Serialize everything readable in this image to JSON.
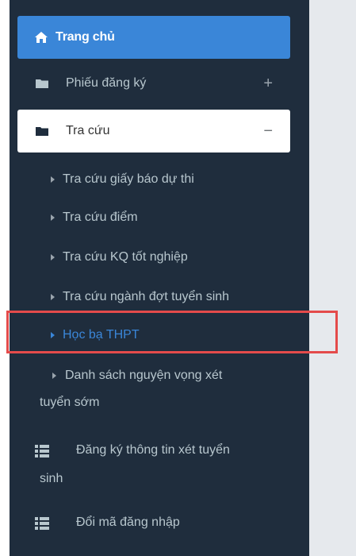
{
  "sidebar": {
    "home": {
      "label": "Trang chủ",
      "icon": "home-icon"
    },
    "registration": {
      "label": "Phiếu đăng ký",
      "icon": "folder-icon",
      "toggle": "+"
    },
    "lookup": {
      "label": "Tra cứu",
      "icon": "folder-open-icon",
      "toggle": "−"
    },
    "lookup_items": [
      {
        "label": "Tra cứu giấy báo dự thi"
      },
      {
        "label": "Tra cứu điểm"
      },
      {
        "label": "Tra cứu KQ tốt nghiệp"
      },
      {
        "label": "Tra cứu ngành đợt tuyển sinh"
      },
      {
        "label": "Học bạ THPT"
      }
    ],
    "early_admission": {
      "line1": "Danh sách nguyện vọng xét",
      "line2": "tuyển sớm"
    },
    "admission_info": {
      "line1": "Đăng ký thông tin xét tuyển",
      "line2": "sinh",
      "icon": "list-icon"
    },
    "change_password": {
      "label": "Đổi mã đăng nhập",
      "icon": "list-icon"
    }
  },
  "colors": {
    "sidebar_bg": "#1f2d3d",
    "active_blue": "#3a86d8",
    "highlight_red": "#e44b4b",
    "muted_text": "#b8c7ce",
    "content_bg": "#e6e9ed"
  }
}
